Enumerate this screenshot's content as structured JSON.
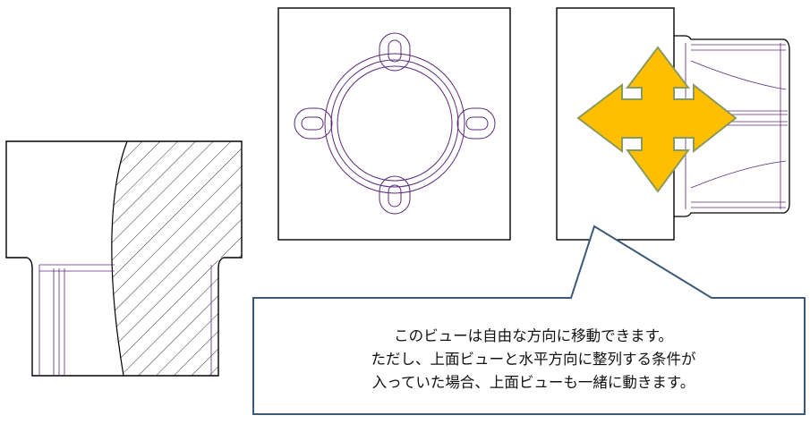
{
  "colors": {
    "outline": "#000000",
    "feature_line": "#5a2a7a",
    "hatch": "#333333",
    "move_arrow_fill": "#ffbf00",
    "move_arrow_stroke": "#8a9a5b",
    "callout_border": "#3c5a78"
  },
  "icons": {
    "move": "four-way-move-arrow-icon"
  },
  "callout": {
    "lines": [
      "このビューは自由な方向に移動できます。",
      "ただし、上面ビューと水平方向に整列する条件が",
      "入っていた場合、上面ビューも一緒に動きます。"
    ]
  }
}
